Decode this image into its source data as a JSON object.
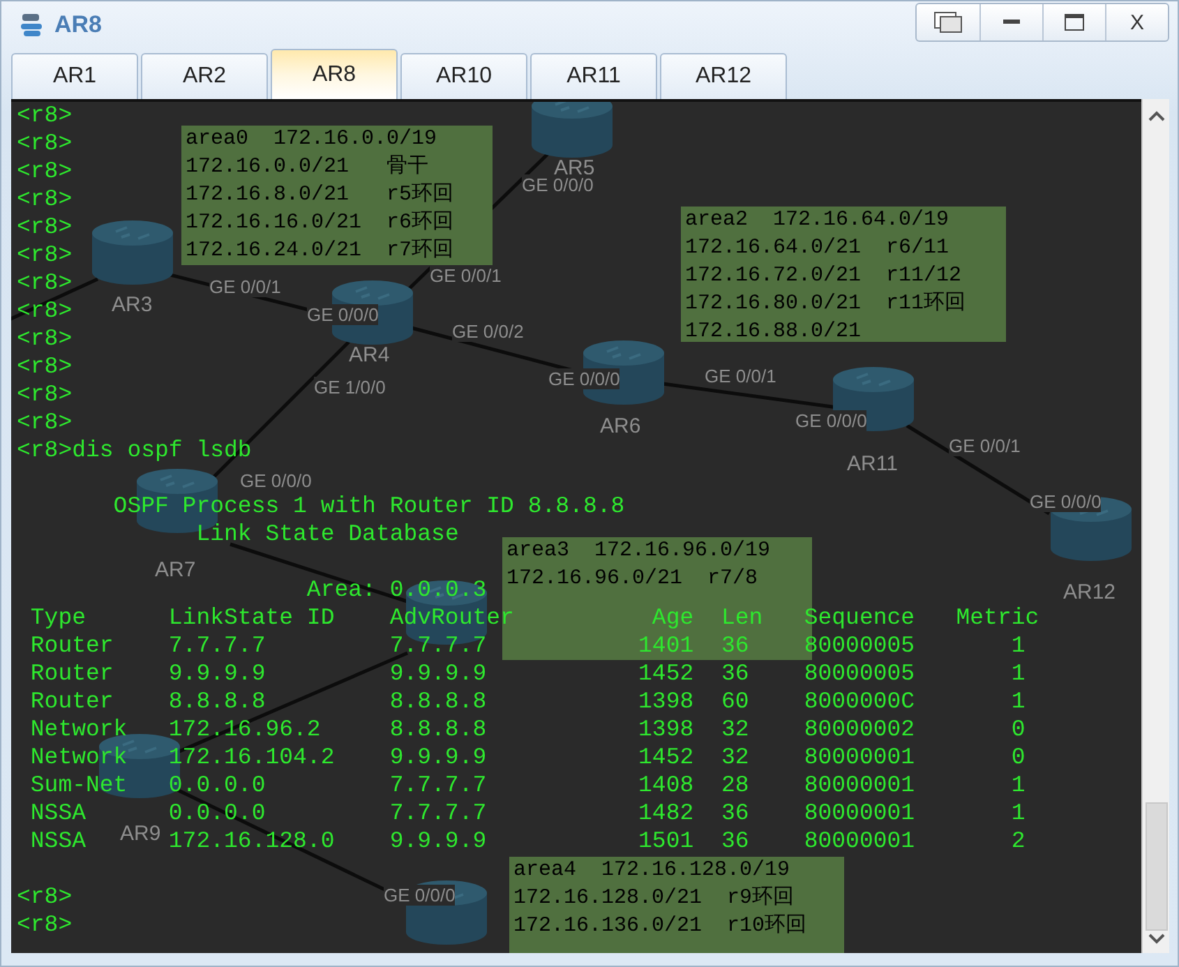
{
  "window": {
    "title": "AR8",
    "controls": [
      {
        "kind": "restore"
      },
      {
        "kind": "minimize"
      },
      {
        "kind": "maximize"
      },
      {
        "kind": "close",
        "label": "X"
      }
    ]
  },
  "tabs": [
    {
      "label": "AR1",
      "selected": false
    },
    {
      "label": "AR2",
      "selected": false
    },
    {
      "label": "AR8",
      "selected": true
    },
    {
      "label": "AR10",
      "selected": false
    },
    {
      "label": "AR11",
      "selected": false
    },
    {
      "label": "AR12",
      "selected": false
    }
  ],
  "topology": {
    "routers": [
      {
        "kind": "router",
        "label": "AR5"
      },
      {
        "kind": "router",
        "label": "AR3"
      },
      {
        "kind": "router",
        "label": "AR4"
      },
      {
        "kind": "router",
        "label": "AR6"
      },
      {
        "kind": "router",
        "label": "AR11"
      },
      {
        "kind": "router",
        "label": "AR7"
      },
      {
        "kind": "router",
        "label": "AR12"
      },
      {
        "kind": "router"
      },
      {
        "kind": "router",
        "label": "AR9"
      },
      {
        "kind": "router"
      }
    ],
    "links": [
      {
        "kind": "link",
        "labels": [
          "GE 0/0/1",
          "GE 0/0/0"
        ]
      },
      {
        "kind": "link"
      },
      {
        "kind": "link",
        "labels": [
          "GE 0/0/1",
          "GE 0/0/0"
        ]
      },
      {
        "kind": "link",
        "labels": [
          "GE 0/0/2",
          "GE 0/0/0"
        ]
      },
      {
        "kind": "link",
        "labels": [
          "GE 1/0/0",
          "GE 0/0/0"
        ]
      },
      {
        "kind": "link",
        "labels": [
          "GE 0/0/1",
          "GE 0/0/0"
        ]
      },
      {
        "kind": "link",
        "labels": [
          "GE 0/0/1",
          "GE 0/0/0"
        ]
      },
      {
        "kind": "link"
      },
      {
        "kind": "link"
      },
      {
        "kind": "link",
        "labels": [
          "GE 0/0/0"
        ]
      }
    ],
    "notes": [
      {
        "lines": [
          "area0  172.16.0.0/19",
          "172.16.0.0/21   骨干",
          "172.16.8.0/21   r5环回",
          "172.16.16.0/21  r6环回",
          "172.16.24.0/21  r7环回"
        ]
      },
      {
        "lines": [
          "area2  172.16.64.0/19",
          "172.16.64.0/21  r6/11",
          "172.16.72.0/21  r11/12",
          "172.16.80.0/21  r11环回",
          "172.16.88.0/21"
        ]
      },
      {
        "lines": [
          "area3  172.16.96.0/19",
          "172.16.96.0/21  r7/8"
        ]
      },
      {
        "lines": [
          "area4  172.16.128.0/19",
          "172.16.128.0/21  r9环回",
          "172.16.136.0/21  r10环回"
        ]
      }
    ]
  },
  "terminal": {
    "lines_before": [
      {
        "kind": "prompt",
        "text": "<r8>"
      },
      {
        "kind": "prompt",
        "text": "<r8>"
      },
      {
        "kind": "prompt",
        "text": "<r8>"
      },
      {
        "kind": "prompt",
        "text": "<r8>"
      },
      {
        "kind": "prompt",
        "text": "<r8>"
      },
      {
        "kind": "prompt",
        "text": "<r8>"
      },
      {
        "kind": "prompt",
        "text": "<r8>"
      },
      {
        "kind": "prompt",
        "text": "<r8>"
      },
      {
        "kind": "prompt",
        "text": "<r8>"
      },
      {
        "kind": "prompt",
        "text": "<r8>"
      },
      {
        "kind": "prompt",
        "text": "<r8>"
      },
      {
        "kind": "prompt",
        "text": "<r8>"
      },
      {
        "kind": "command",
        "text": "<r8>dis ospf lsdb"
      },
      {
        "kind": "blank"
      },
      {
        "kind": "title",
        "text": "OSPF Process 1 with Router ID 8.8.8.8"
      },
      {
        "kind": "subtitle",
        "text": "Link State Database"
      },
      {
        "kind": "blank"
      },
      {
        "kind": "area",
        "text": "Area: 0.0.0.3"
      }
    ],
    "table": {
      "columns": [
        "Type",
        "LinkState ID",
        "AdvRouter",
        "Age",
        "Len",
        "Sequence",
        "Metric"
      ],
      "rows": [
        [
          "Router",
          "7.7.7.7",
          "7.7.7.7",
          "1401",
          "36",
          "80000005",
          "1"
        ],
        [
          "Router",
          "9.9.9.9",
          "9.9.9.9",
          "1452",
          "36",
          "80000005",
          "1"
        ],
        [
          "Router",
          "8.8.8.8",
          "8.8.8.8",
          "1398",
          "60",
          "8000000C",
          "1"
        ],
        [
          "Network",
          "172.16.96.2",
          "8.8.8.8",
          "1398",
          "32",
          "80000002",
          "0"
        ],
        [
          "Network",
          "172.16.104.2",
          "9.9.9.9",
          "1452",
          "32",
          "80000001",
          "0"
        ],
        [
          "Sum-Net",
          "0.0.0.0",
          "7.7.7.7",
          "1408",
          "28",
          "80000001",
          "1"
        ],
        [
          "NSSA",
          "0.0.0.0",
          "7.7.7.7",
          "1482",
          "36",
          "80000001",
          "1"
        ],
        [
          "NSSA",
          "172.16.128.0",
          "9.9.9.9",
          "1501",
          "36",
          "80000001",
          "2"
        ]
      ]
    },
    "lines_after": [
      {
        "kind": "blank"
      },
      {
        "kind": "prompt",
        "text": "<r8>"
      },
      {
        "kind": "prompt",
        "text": "<r8>"
      }
    ]
  }
}
